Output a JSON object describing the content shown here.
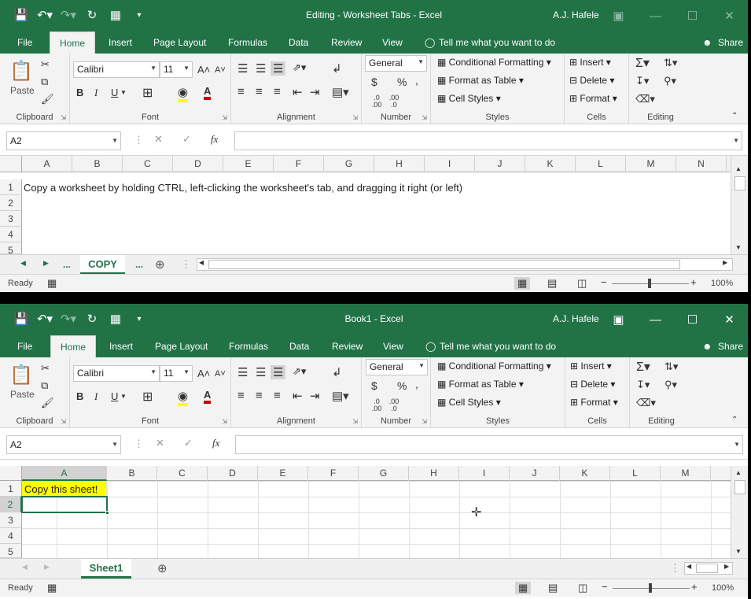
{
  "w1": {
    "title": "Editing - Worksheet Tabs  -  Excel",
    "user": "A.J. Hafele",
    "tabs": [
      "File",
      "Home",
      "Insert",
      "Page Layout",
      "Formulas",
      "Data",
      "Review",
      "View"
    ],
    "tell_me": "Tell me what you want to do",
    "share": "Share",
    "name_box": "A2",
    "columns": [
      "A",
      "B",
      "C",
      "D",
      "E",
      "F",
      "G",
      "H",
      "I",
      "J",
      "K",
      "L",
      "M",
      "N"
    ],
    "rows": [
      "1",
      "2",
      "3",
      "4",
      "5"
    ],
    "a1": "Copy a worksheet by holding CTRL, left-clicking the worksheet's tab, and dragging it right (or left)",
    "sheet_tab": "COPY",
    "ellipsis": "...",
    "status": "Ready",
    "zoom": "100%"
  },
  "w2": {
    "title": "Book1  -  Excel",
    "user": "A.J. Hafele",
    "tabs": [
      "File",
      "Home",
      "Insert",
      "Page Layout",
      "Formulas",
      "Data",
      "Review",
      "View"
    ],
    "tell_me": "Tell me what you want to do",
    "share": "Share",
    "name_box": "A2",
    "columns": [
      "A",
      "B",
      "C",
      "D",
      "E",
      "F",
      "G",
      "H",
      "I",
      "J",
      "K",
      "L",
      "M"
    ],
    "rows": [
      "1",
      "2",
      "3",
      "4",
      "5"
    ],
    "a1": "Copy this sheet!",
    "sheet_tab": "Sheet1",
    "status": "Ready",
    "zoom": "100%"
  },
  "ribbon": {
    "paste": "Paste",
    "font_name": "Calibri",
    "font_size": "11",
    "number_format": "General",
    "cond_format": "Conditional Formatting",
    "format_table": "Format as Table",
    "cell_styles": "Cell Styles",
    "insert": "Insert",
    "delete": "Delete",
    "format": "Format",
    "groups": {
      "clipboard": "Clipboard",
      "font": "Font",
      "alignment": "Alignment",
      "number": "Number",
      "styles": "Styles",
      "cells": "Cells",
      "editing": "Editing"
    },
    "bold": "B",
    "italic": "I",
    "underline": "U",
    "currency": "$",
    "percent": "%",
    "comma": ",",
    "fx": "fx",
    "inc_decimal": ".0 .00",
    "dec_decimal": ".00 .0"
  },
  "colors": {
    "excel_green": "#217346",
    "highlight": "#ffff00",
    "font_red": "#c00000"
  }
}
